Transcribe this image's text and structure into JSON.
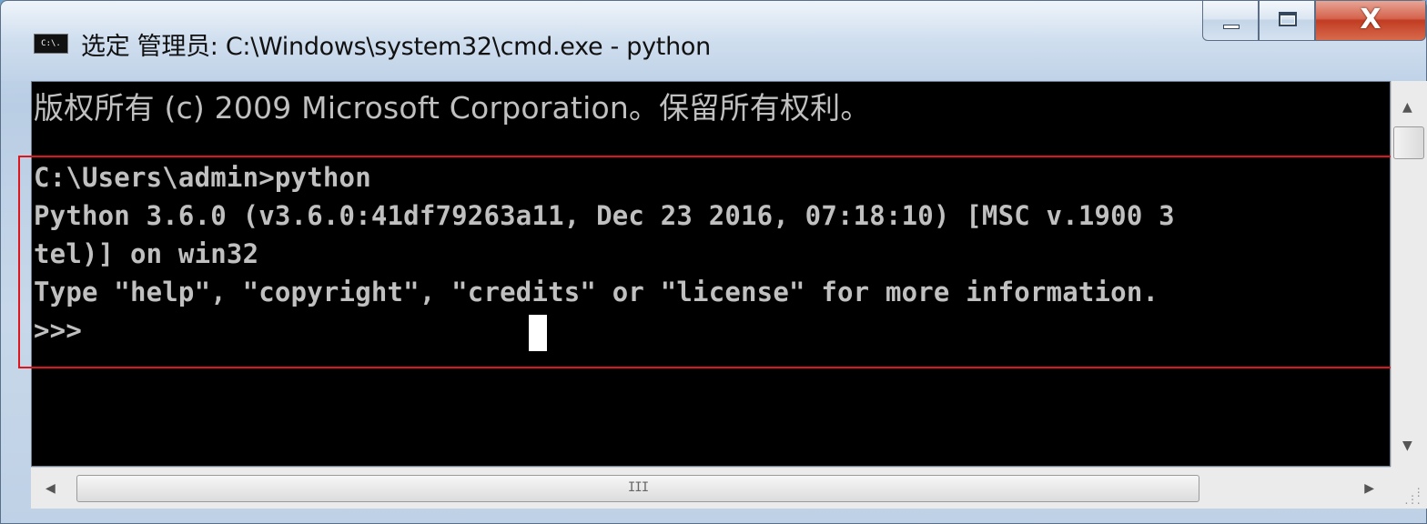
{
  "window": {
    "icon_label": "C:\\.",
    "title": "选定 管理员: C:\\Windows\\system32\\cmd.exe - python",
    "buttons": {
      "minimize": "minimize",
      "maximize": "maximize",
      "close": "X"
    }
  },
  "console": {
    "lines": [
      "版权所有 (c) 2009 Microsoft Corporation。保留所有权利。",
      "",
      "C:\\Users\\admin>python",
      "Python 3.6.0 (v3.6.0:41df79263a11, Dec 23 2016, 07:18:10) [MSC v.1900 3",
      "tel)] on win32",
      "Type \"help\", \"copyright\", \"credits\" or \"license\" for more information.",
      ">>>"
    ],
    "cursor": "block",
    "highlight_color": "#e0141b"
  },
  "scrollbars": {
    "up_arrow": "up-arrow-icon",
    "down_arrow": "down-arrow-icon",
    "left_arrow": "left-arrow-icon",
    "right_arrow": "right-arrow-icon",
    "thumb_grip": "III"
  }
}
